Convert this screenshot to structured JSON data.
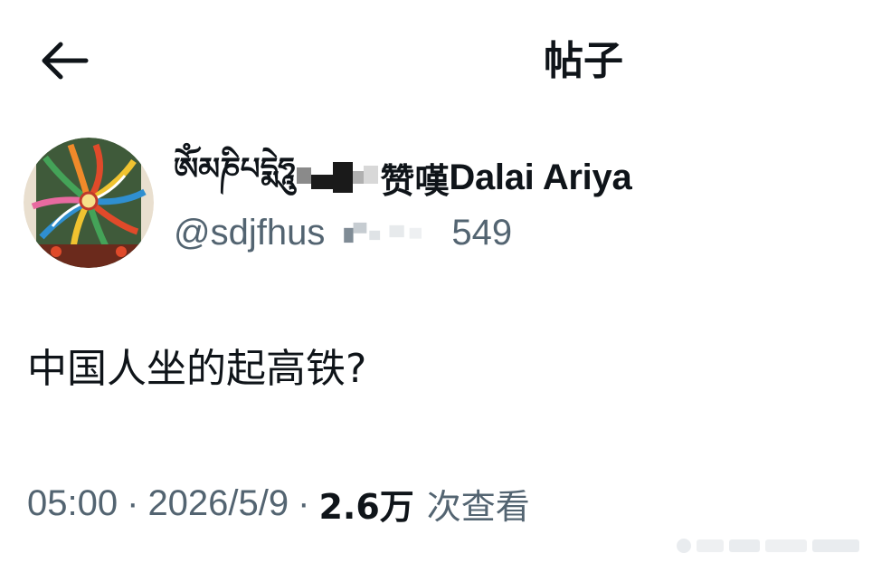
{
  "header": {
    "title": "帖子",
    "back_icon": "arrow-left-icon"
  },
  "author": {
    "display_name_tibetan": "ཨོཾམཎིཔདྨེཧཱུ",
    "display_name_cjk": "赞嘆",
    "display_name_latin": "Dalai Ariya",
    "handle_prefix": "@sdjfhus",
    "handle_suffix": "549",
    "avatar_icon": "mandala-avatar"
  },
  "post": {
    "text": "中国人坐的起高铁?"
  },
  "meta": {
    "time": "05:00",
    "separator": "·",
    "date": "2026/5/9",
    "views_count": "2.6万",
    "views_label": "次查看"
  },
  "colors": {
    "text_primary": "#0f1419",
    "text_secondary": "#536471",
    "background": "#ffffff"
  }
}
